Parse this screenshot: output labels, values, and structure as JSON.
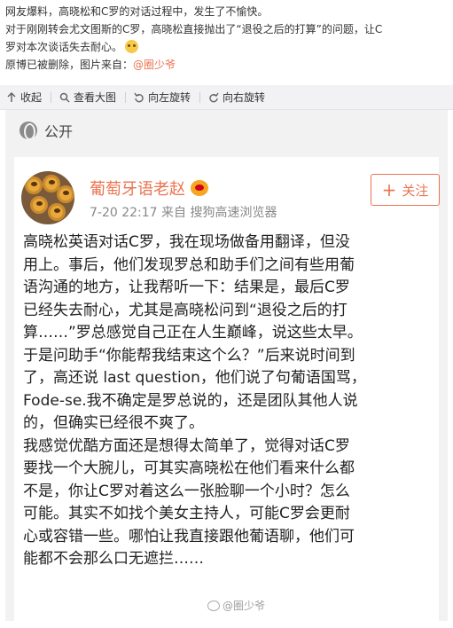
{
  "post": {
    "line1": "网友爆料，高晓松和C罗的对话过程中，发生了不愉快。",
    "line2": "对于刚刚转会尤文图斯的C罗，高晓松直接抛出了“退役之后的打算”的问题，让C",
    "line3": "罗对本次谈话失去耐心。",
    "emoji": "smiley-emoji",
    "line4_prefix": "原博已被删除，图片来自：",
    "line4_mention": "@圈少爷"
  },
  "toolbar": {
    "collapse": "收起",
    "view_large": "查看大图",
    "rotate_left": "向左旋转",
    "rotate_right": "向右旋转"
  },
  "screenshot": {
    "visibility": "公开",
    "author": "葡萄牙语老赵",
    "timestamp": "7-20 22:17",
    "source": "来自 搜狗高速浏览器",
    "follow_label": "关注",
    "body_lines": [
      "高晓松英语对话C罗，我在现场做备用翻译，但没",
      "用上。事后，他们发现罗总和助手们之间有些用葡",
      "语沟通的地方，让我帮听一下：结果是，最后C罗",
      "已经失去耐心，尤其是高晓松问到“退役之后的打",
      "算……”罗总感觉自己正在人生巅峰，说这些太早。",
      "于是问助手“你能帮我结束这个么？”后来说时间到",
      "了，高还说 last question，他们说了句葡语国骂，",
      "Fode-se.我不确定是罗总说的，还是团队其他人说",
      "的，但确实已经很不爽了。",
      "我感觉优酷方面还是想得太简单了，觉得对话C罗",
      "要找一个大腕儿，可其实高晓松在他们看来什么都",
      "不是，你让C罗对着这么一张脸聊一个小时？怎么",
      "可能。其实不如找个美女主持人，可能C罗会更耐",
      "心或容错一些。哪怕让我直接跟他葡语聊，他们可",
      "能都不会那么口无遮拦……"
    ],
    "watermark": "@圈少爷"
  },
  "colors": {
    "accent": "#eb7350",
    "toolbar_bg": "#f2f2f5",
    "screenshot_bg": "#f2f2f2"
  }
}
